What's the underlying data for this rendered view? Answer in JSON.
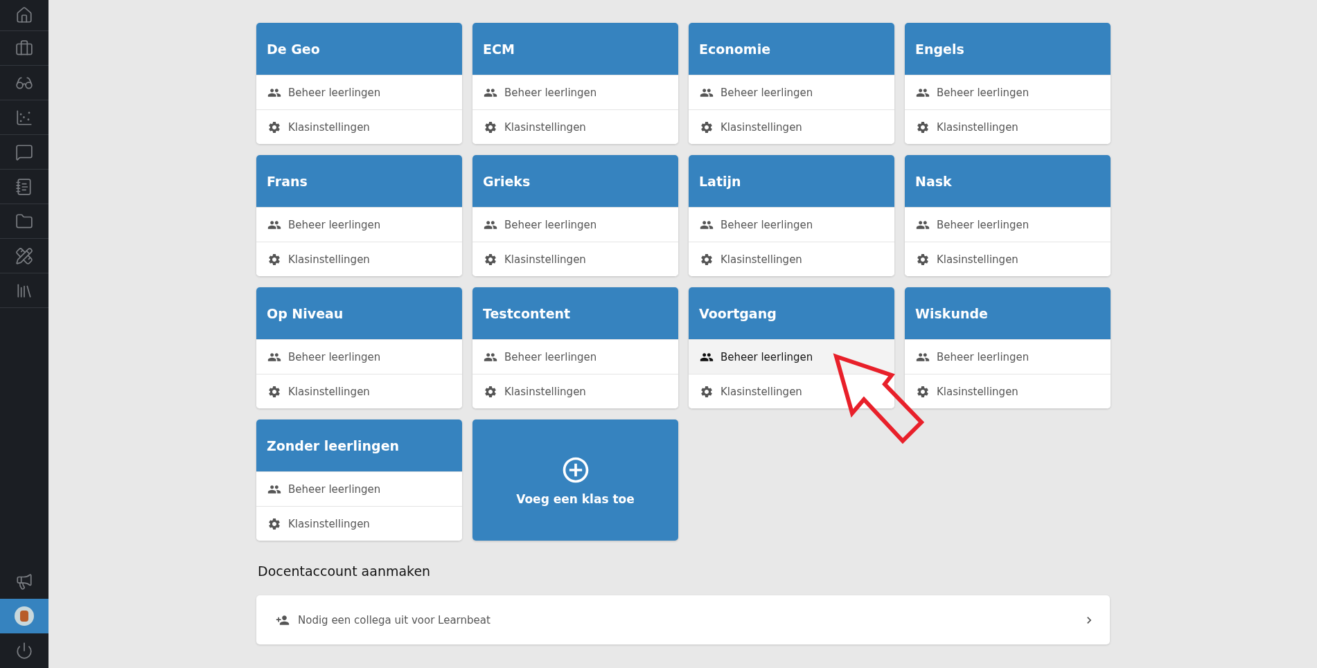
{
  "sidebar": {
    "items": [
      {
        "kind": "home",
        "selected": false
      },
      {
        "kind": "briefcase",
        "selected": false
      },
      {
        "kind": "glasses",
        "selected": false
      },
      {
        "kind": "scatter",
        "selected": false
      },
      {
        "kind": "chat",
        "selected": false
      },
      {
        "kind": "notepad",
        "selected": false
      },
      {
        "kind": "folder",
        "selected": false
      },
      {
        "kind": "tools",
        "selected": false
      },
      {
        "kind": "library",
        "selected": false
      }
    ],
    "bottom_items": [
      {
        "kind": "megaphone",
        "selected": false
      },
      {
        "kind": "avatar",
        "selected": true
      },
      {
        "kind": "power",
        "selected": false
      }
    ]
  },
  "classes": [
    {
      "title": "De Geo",
      "actions": [
        {
          "kind": "students",
          "label": "Beheer leerlingen",
          "hovered": false
        },
        {
          "kind": "settings",
          "label": "Klasinstellingen",
          "hovered": false
        }
      ]
    },
    {
      "title": "ECM",
      "actions": [
        {
          "kind": "students",
          "label": "Beheer leerlingen",
          "hovered": false
        },
        {
          "kind": "settings",
          "label": "Klasinstellingen",
          "hovered": false
        }
      ]
    },
    {
      "title": "Economie",
      "actions": [
        {
          "kind": "students",
          "label": "Beheer leerlingen",
          "hovered": false
        },
        {
          "kind": "settings",
          "label": "Klasinstellingen",
          "hovered": false
        }
      ]
    },
    {
      "title": "Engels",
      "actions": [
        {
          "kind": "students",
          "label": "Beheer leerlingen",
          "hovered": false
        },
        {
          "kind": "settings",
          "label": "Klasinstellingen",
          "hovered": false
        }
      ]
    },
    {
      "title": "Frans",
      "actions": [
        {
          "kind": "students",
          "label": "Beheer leerlingen",
          "hovered": false
        },
        {
          "kind": "settings",
          "label": "Klasinstellingen",
          "hovered": false
        }
      ]
    },
    {
      "title": "Grieks",
      "actions": [
        {
          "kind": "students",
          "label": "Beheer leerlingen",
          "hovered": false
        },
        {
          "kind": "settings",
          "label": "Klasinstellingen",
          "hovered": false
        }
      ]
    },
    {
      "title": "Latijn",
      "actions": [
        {
          "kind": "students",
          "label": "Beheer leerlingen",
          "hovered": false
        },
        {
          "kind": "settings",
          "label": "Klasinstellingen",
          "hovered": false
        }
      ]
    },
    {
      "title": "Nask",
      "actions": [
        {
          "kind": "students",
          "label": "Beheer leerlingen",
          "hovered": false
        },
        {
          "kind": "settings",
          "label": "Klasinstellingen",
          "hovered": false
        }
      ]
    },
    {
      "title": "Op Niveau",
      "actions": [
        {
          "kind": "students",
          "label": "Beheer leerlingen",
          "hovered": false
        },
        {
          "kind": "settings",
          "label": "Klasinstellingen",
          "hovered": false
        }
      ]
    },
    {
      "title": "Testcontent",
      "actions": [
        {
          "kind": "students",
          "label": "Beheer leerlingen",
          "hovered": false
        },
        {
          "kind": "settings",
          "label": "Klasinstellingen",
          "hovered": false
        }
      ]
    },
    {
      "title": "Voortgang",
      "actions": [
        {
          "kind": "students",
          "label": "Beheer leerlingen",
          "hovered": true
        },
        {
          "kind": "settings",
          "label": "Klasinstellingen",
          "hovered": false
        }
      ]
    },
    {
      "title": "Wiskunde",
      "actions": [
        {
          "kind": "students",
          "label": "Beheer leerlingen",
          "hovered": false
        },
        {
          "kind": "settings",
          "label": "Klasinstellingen",
          "hovered": false
        }
      ]
    },
    {
      "title": "Zonder leerlingen",
      "actions": [
        {
          "kind": "students",
          "label": "Beheer leerlingen",
          "hovered": false
        },
        {
          "kind": "settings",
          "label": "Klasinstellingen",
          "hovered": false
        }
      ]
    }
  ],
  "add_class": {
    "label": "Voeg een klas toe"
  },
  "teacher_account": {
    "heading": "Docentaccount aanmaken",
    "invite": {
      "label": "Nodig een collega uit voor Learnbeat"
    }
  },
  "annotation": {
    "kind": "arrow"
  }
}
